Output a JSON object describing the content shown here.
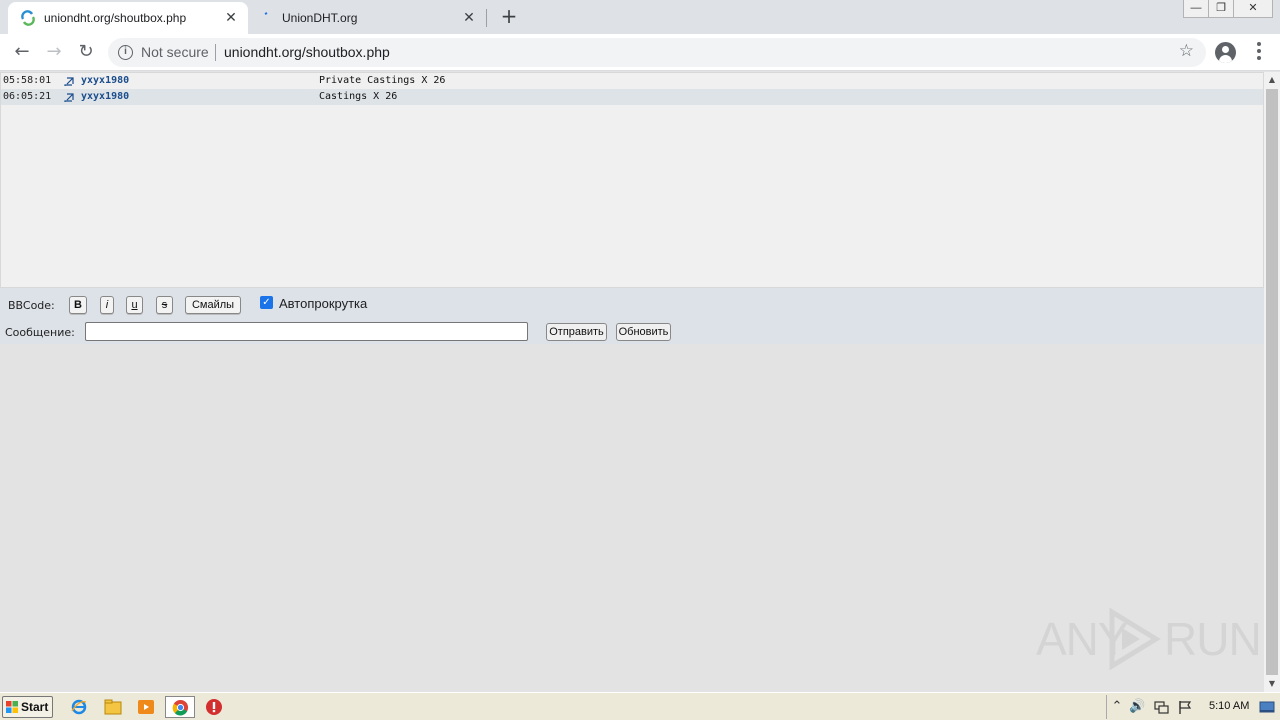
{
  "browser": {
    "tabs": [
      {
        "title": "uniondht.org/shoutbox.php",
        "active": true
      },
      {
        "title": "UnionDHT.org",
        "active": false
      }
    ],
    "close_glyph": "✕",
    "new_tab_glyph": "+",
    "window_controls": {
      "minimize": "—",
      "restore": "❐",
      "close": "✕"
    },
    "nav": {
      "back": "←",
      "forward": "→",
      "reload": "↻"
    },
    "omnibox": {
      "info_glyph": "i",
      "security_text": "Not secure",
      "url": "uniondht.org/shoutbox.php",
      "star_glyph": "☆"
    }
  },
  "shoutbox": {
    "messages": [
      {
        "time": "05:58:01",
        "user": "yxyx1980",
        "text": "Private Castings X 26"
      },
      {
        "time": "06:05:21",
        "user": "yxyx1980",
        "text": "Castings X 26"
      }
    ]
  },
  "controls": {
    "bbcode_label": "BBCode:",
    "bold_label": "B",
    "italic_label": "i",
    "underline_label": "u",
    "strike_label": "s",
    "smileys_label": "Смайлы",
    "autoscroll_label": "Автопрокрутка",
    "autoscroll_checked": true,
    "checkmark": "✓",
    "message_label": "Сообщение:",
    "message_value": "",
    "send_label": "Отправить",
    "refresh_label": "Обновить"
  },
  "scrollbar": {
    "up_glyph": "▲",
    "down_glyph": "▼"
  },
  "watermark": {
    "left_text": "ANY",
    "right_text": "RUN"
  },
  "taskbar": {
    "start_label": "Start",
    "tray_glyphs": {
      "chevron": "⌃",
      "volume": "🔊"
    },
    "clock": "5:10 AM"
  },
  "colors": {
    "accent": "#1a73e8",
    "username": "#1b4d8c",
    "alt_row": "#dee3e8",
    "controls_bg": "#dde2e8"
  }
}
